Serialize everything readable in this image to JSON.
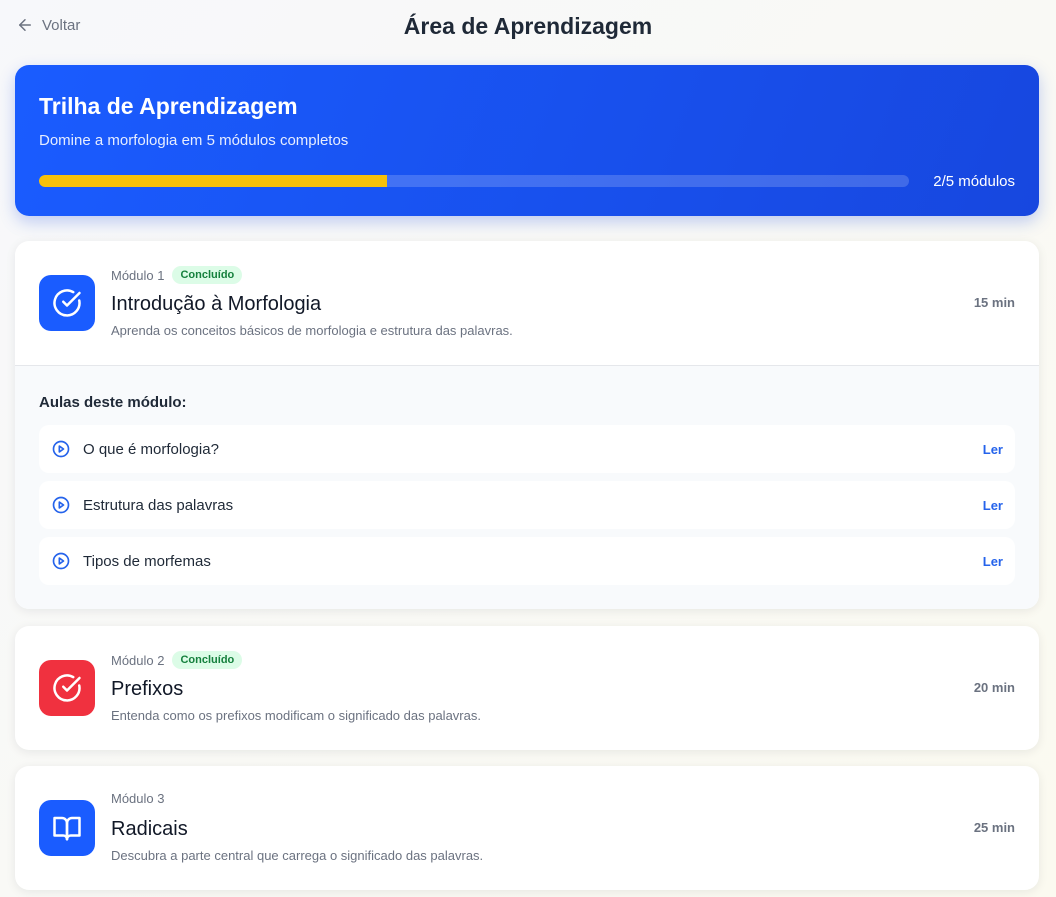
{
  "header": {
    "back_label": "Voltar",
    "title": "Área de Aprendizagem"
  },
  "hero": {
    "title": "Trilha de Aprendizagem",
    "subtitle": "Domine a morfologia em 5 módulos completos",
    "progress_label": "2/5 módulos",
    "progress_fraction": 0.4,
    "progress_color": "#f7c10a"
  },
  "modules": [
    {
      "number_label": "Módulo 1",
      "badge": "Concluído",
      "title": "Introdução à Morfologia",
      "description": "Aprenda os conceitos básicos de morfologia e estrutura das palavras.",
      "time": "15 min",
      "icon": "check-circle-icon",
      "icon_color": "#1a5cff",
      "lessons_title": "Aulas deste módulo:",
      "lessons": [
        {
          "label": "O que é morfologia?",
          "action": "Ler"
        },
        {
          "label": "Estrutura das palavras",
          "action": "Ler"
        },
        {
          "label": "Tipos de morfemas",
          "action": "Ler"
        }
      ]
    },
    {
      "number_label": "Módulo 2",
      "badge": "Concluído",
      "title": "Prefixos",
      "description": "Entenda como os prefixos modificam o significado das palavras.",
      "time": "20 min",
      "icon": "check-circle-icon",
      "icon_color": "#f0313f"
    },
    {
      "number_label": "Módulo 3",
      "title": "Radicais",
      "description": "Descubra a parte central que carrega o significado das palavras.",
      "time": "25 min",
      "icon": "book-open-icon",
      "icon_color": "#1a5cff"
    }
  ]
}
